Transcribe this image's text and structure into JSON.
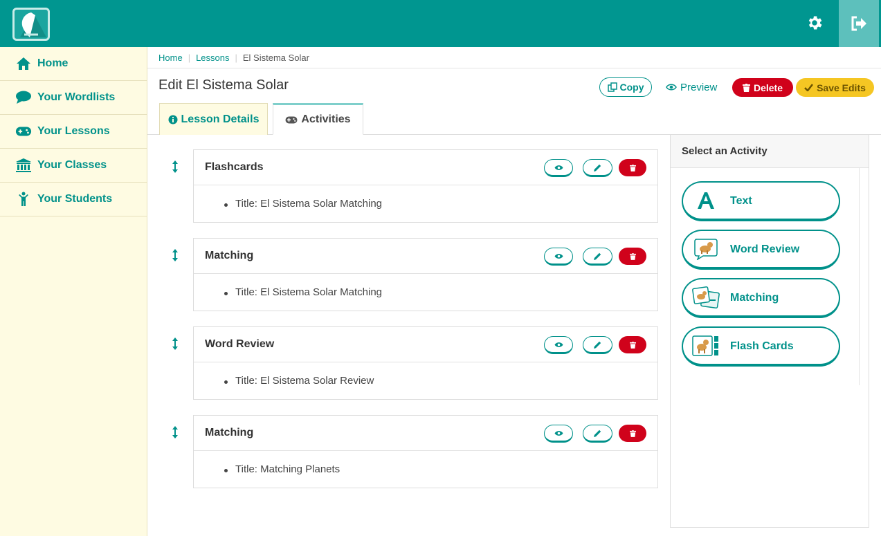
{
  "topbar": {
    "logo_icon": "app-logo",
    "settings_icon": "gear-icon",
    "logout_icon": "sign-out-icon"
  },
  "sidebar": {
    "items": [
      {
        "label": "Home",
        "icon": "home-icon"
      },
      {
        "label": "Your Wordlists",
        "icon": "speech-bubble-icon"
      },
      {
        "label": "Your Lessons",
        "icon": "gamepad-icon"
      },
      {
        "label": "Your Classes",
        "icon": "institution-icon"
      },
      {
        "label": "Your Students",
        "icon": "child-icon"
      }
    ]
  },
  "breadcrumb": {
    "items": [
      "Home",
      "Lessons"
    ],
    "current": "El Sistema Solar"
  },
  "header": {
    "title": "Edit El Sistema Solar",
    "copy_label": "Copy",
    "preview_label": "Preview",
    "delete_label": "Delete",
    "save_label": "Save Edits"
  },
  "tabs": [
    {
      "label": "Lesson Details",
      "icon": "info-circle-icon"
    },
    {
      "label": "Activities",
      "icon": "gamepad-icon"
    }
  ],
  "activities": [
    {
      "name": "Flashcards",
      "detail": "Title: El Sistema Solar Matching"
    },
    {
      "name": "Matching",
      "detail": "Title: El Sistema Solar Matching"
    },
    {
      "name": "Word Review",
      "detail": "Title: El Sistema Solar Review"
    },
    {
      "name": "Matching",
      "detail": "Title: Matching Planets"
    }
  ],
  "activity_panel": {
    "title": "Select an Activity",
    "options": [
      {
        "label": "Text",
        "icon": "text-a-icon"
      },
      {
        "label": "Word Review",
        "icon": "dog-speech-icon"
      },
      {
        "label": "Matching",
        "icon": "dog-cards-icon"
      },
      {
        "label": "Flash Cards",
        "icon": "dog-flashcard-icon"
      }
    ]
  },
  "colors": {
    "primary": "#009690",
    "sidebar_bg": "#fefbe2",
    "danger": "#d0021b",
    "warning": "#f5c623"
  }
}
